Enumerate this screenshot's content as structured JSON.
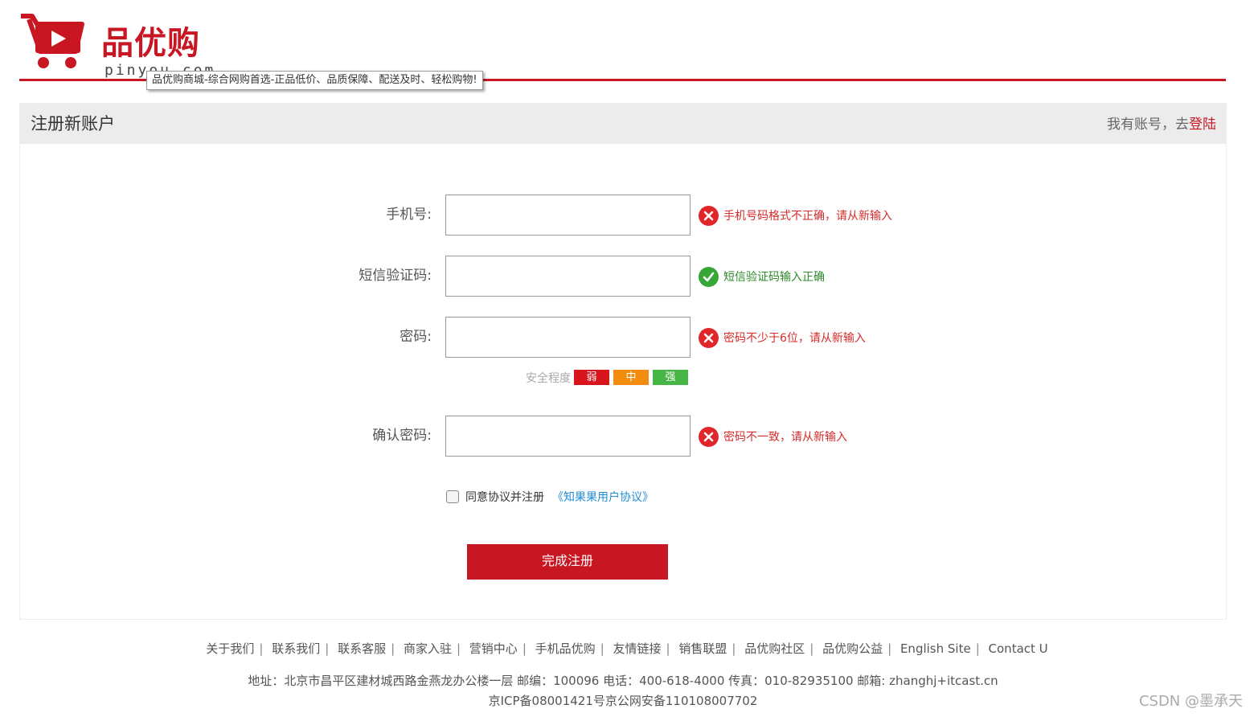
{
  "header": {
    "logo_text": "品优购",
    "logo_domain": "pinyou.com",
    "tooltip": "品优购商城-综合网购首选-正品低价、品质保障、配送及时、轻松购物!"
  },
  "register": {
    "title": "注册新账户",
    "login_prompt": "我有账号，去",
    "login_link": "登陆",
    "fields": [
      {
        "label": "手机号:",
        "value": "",
        "message": "手机号码格式不正确，请从新输入",
        "status": "error"
      },
      {
        "label": "短信验证码:",
        "value": "",
        "message": "短信验证码输入正确",
        "status": "success"
      },
      {
        "label": "密码:",
        "value": "",
        "message": "密码不少于6位，请从新输入",
        "status": "error"
      },
      {
        "label": "确认密码:",
        "value": "",
        "message": "密码不一致，请从新输入",
        "status": "error"
      }
    ],
    "strength": {
      "label": "安全程度",
      "levels": [
        "弱",
        "中",
        "强"
      ]
    },
    "agree_text": "同意协议并注册",
    "agree_link": "《知果果用户协议》",
    "submit_label": "完成注册"
  },
  "footer": {
    "links": [
      "关于我们",
      "联系我们",
      "联系客服",
      "商家入驻",
      "营销中心",
      "手机品优购",
      "友情链接",
      "销售联盟",
      "品优购社区",
      "品优购公益",
      "English Site",
      "Contact U"
    ],
    "address": "地址：北京市昌平区建材城西路金燕龙办公楼一层 邮编：100096 电话：400-618-4000 传真：010-82935100 邮箱: zhanghj+itcast.cn",
    "icp": "京ICP备08001421号京公网安备110108007702"
  },
  "watermark": "CSDN @墨承天",
  "colors": {
    "brand": "#c81623",
    "error": "#d62b2b",
    "success": "#36a636",
    "weak": "#d8151c",
    "medium": "#f28c0f",
    "strong": "#46b545"
  },
  "icons": [
    "cart-logo-icon",
    "error-icon",
    "check-icon"
  ]
}
